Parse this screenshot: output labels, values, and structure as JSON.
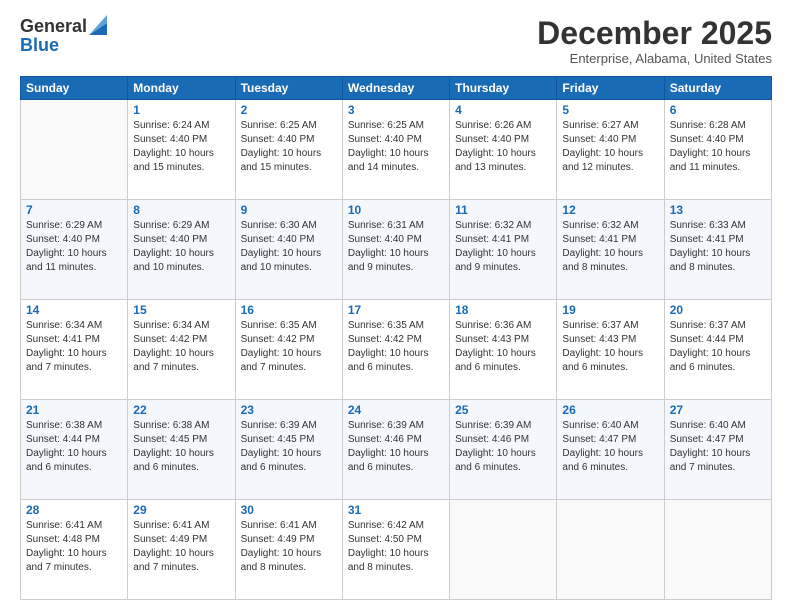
{
  "header": {
    "logo_line1": "General",
    "logo_line2": "Blue",
    "month": "December 2025",
    "location": "Enterprise, Alabama, United States"
  },
  "days_of_week": [
    "Sunday",
    "Monday",
    "Tuesday",
    "Wednesday",
    "Thursday",
    "Friday",
    "Saturday"
  ],
  "weeks": [
    [
      {
        "day": "",
        "info": ""
      },
      {
        "day": "1",
        "info": "Sunrise: 6:24 AM\nSunset: 4:40 PM\nDaylight: 10 hours\nand 15 minutes."
      },
      {
        "day": "2",
        "info": "Sunrise: 6:25 AM\nSunset: 4:40 PM\nDaylight: 10 hours\nand 15 minutes."
      },
      {
        "day": "3",
        "info": "Sunrise: 6:25 AM\nSunset: 4:40 PM\nDaylight: 10 hours\nand 14 minutes."
      },
      {
        "day": "4",
        "info": "Sunrise: 6:26 AM\nSunset: 4:40 PM\nDaylight: 10 hours\nand 13 minutes."
      },
      {
        "day": "5",
        "info": "Sunrise: 6:27 AM\nSunset: 4:40 PM\nDaylight: 10 hours\nand 12 minutes."
      },
      {
        "day": "6",
        "info": "Sunrise: 6:28 AM\nSunset: 4:40 PM\nDaylight: 10 hours\nand 11 minutes."
      }
    ],
    [
      {
        "day": "7",
        "info": "Sunrise: 6:29 AM\nSunset: 4:40 PM\nDaylight: 10 hours\nand 11 minutes."
      },
      {
        "day": "8",
        "info": "Sunrise: 6:29 AM\nSunset: 4:40 PM\nDaylight: 10 hours\nand 10 minutes."
      },
      {
        "day": "9",
        "info": "Sunrise: 6:30 AM\nSunset: 4:40 PM\nDaylight: 10 hours\nand 10 minutes."
      },
      {
        "day": "10",
        "info": "Sunrise: 6:31 AM\nSunset: 4:40 PM\nDaylight: 10 hours\nand 9 minutes."
      },
      {
        "day": "11",
        "info": "Sunrise: 6:32 AM\nSunset: 4:41 PM\nDaylight: 10 hours\nand 9 minutes."
      },
      {
        "day": "12",
        "info": "Sunrise: 6:32 AM\nSunset: 4:41 PM\nDaylight: 10 hours\nand 8 minutes."
      },
      {
        "day": "13",
        "info": "Sunrise: 6:33 AM\nSunset: 4:41 PM\nDaylight: 10 hours\nand 8 minutes."
      }
    ],
    [
      {
        "day": "14",
        "info": "Sunrise: 6:34 AM\nSunset: 4:41 PM\nDaylight: 10 hours\nand 7 minutes."
      },
      {
        "day": "15",
        "info": "Sunrise: 6:34 AM\nSunset: 4:42 PM\nDaylight: 10 hours\nand 7 minutes."
      },
      {
        "day": "16",
        "info": "Sunrise: 6:35 AM\nSunset: 4:42 PM\nDaylight: 10 hours\nand 7 minutes."
      },
      {
        "day": "17",
        "info": "Sunrise: 6:35 AM\nSunset: 4:42 PM\nDaylight: 10 hours\nand 6 minutes."
      },
      {
        "day": "18",
        "info": "Sunrise: 6:36 AM\nSunset: 4:43 PM\nDaylight: 10 hours\nand 6 minutes."
      },
      {
        "day": "19",
        "info": "Sunrise: 6:37 AM\nSunset: 4:43 PM\nDaylight: 10 hours\nand 6 minutes."
      },
      {
        "day": "20",
        "info": "Sunrise: 6:37 AM\nSunset: 4:44 PM\nDaylight: 10 hours\nand 6 minutes."
      }
    ],
    [
      {
        "day": "21",
        "info": "Sunrise: 6:38 AM\nSunset: 4:44 PM\nDaylight: 10 hours\nand 6 minutes."
      },
      {
        "day": "22",
        "info": "Sunrise: 6:38 AM\nSunset: 4:45 PM\nDaylight: 10 hours\nand 6 minutes."
      },
      {
        "day": "23",
        "info": "Sunrise: 6:39 AM\nSunset: 4:45 PM\nDaylight: 10 hours\nand 6 minutes."
      },
      {
        "day": "24",
        "info": "Sunrise: 6:39 AM\nSunset: 4:46 PM\nDaylight: 10 hours\nand 6 minutes."
      },
      {
        "day": "25",
        "info": "Sunrise: 6:39 AM\nSunset: 4:46 PM\nDaylight: 10 hours\nand 6 minutes."
      },
      {
        "day": "26",
        "info": "Sunrise: 6:40 AM\nSunset: 4:47 PM\nDaylight: 10 hours\nand 6 minutes."
      },
      {
        "day": "27",
        "info": "Sunrise: 6:40 AM\nSunset: 4:47 PM\nDaylight: 10 hours\nand 7 minutes."
      }
    ],
    [
      {
        "day": "28",
        "info": "Sunrise: 6:41 AM\nSunset: 4:48 PM\nDaylight: 10 hours\nand 7 minutes."
      },
      {
        "day": "29",
        "info": "Sunrise: 6:41 AM\nSunset: 4:49 PM\nDaylight: 10 hours\nand 7 minutes."
      },
      {
        "day": "30",
        "info": "Sunrise: 6:41 AM\nSunset: 4:49 PM\nDaylight: 10 hours\nand 8 minutes."
      },
      {
        "day": "31",
        "info": "Sunrise: 6:42 AM\nSunset: 4:50 PM\nDaylight: 10 hours\nand 8 minutes."
      },
      {
        "day": "",
        "info": ""
      },
      {
        "day": "",
        "info": ""
      },
      {
        "day": "",
        "info": ""
      }
    ]
  ]
}
